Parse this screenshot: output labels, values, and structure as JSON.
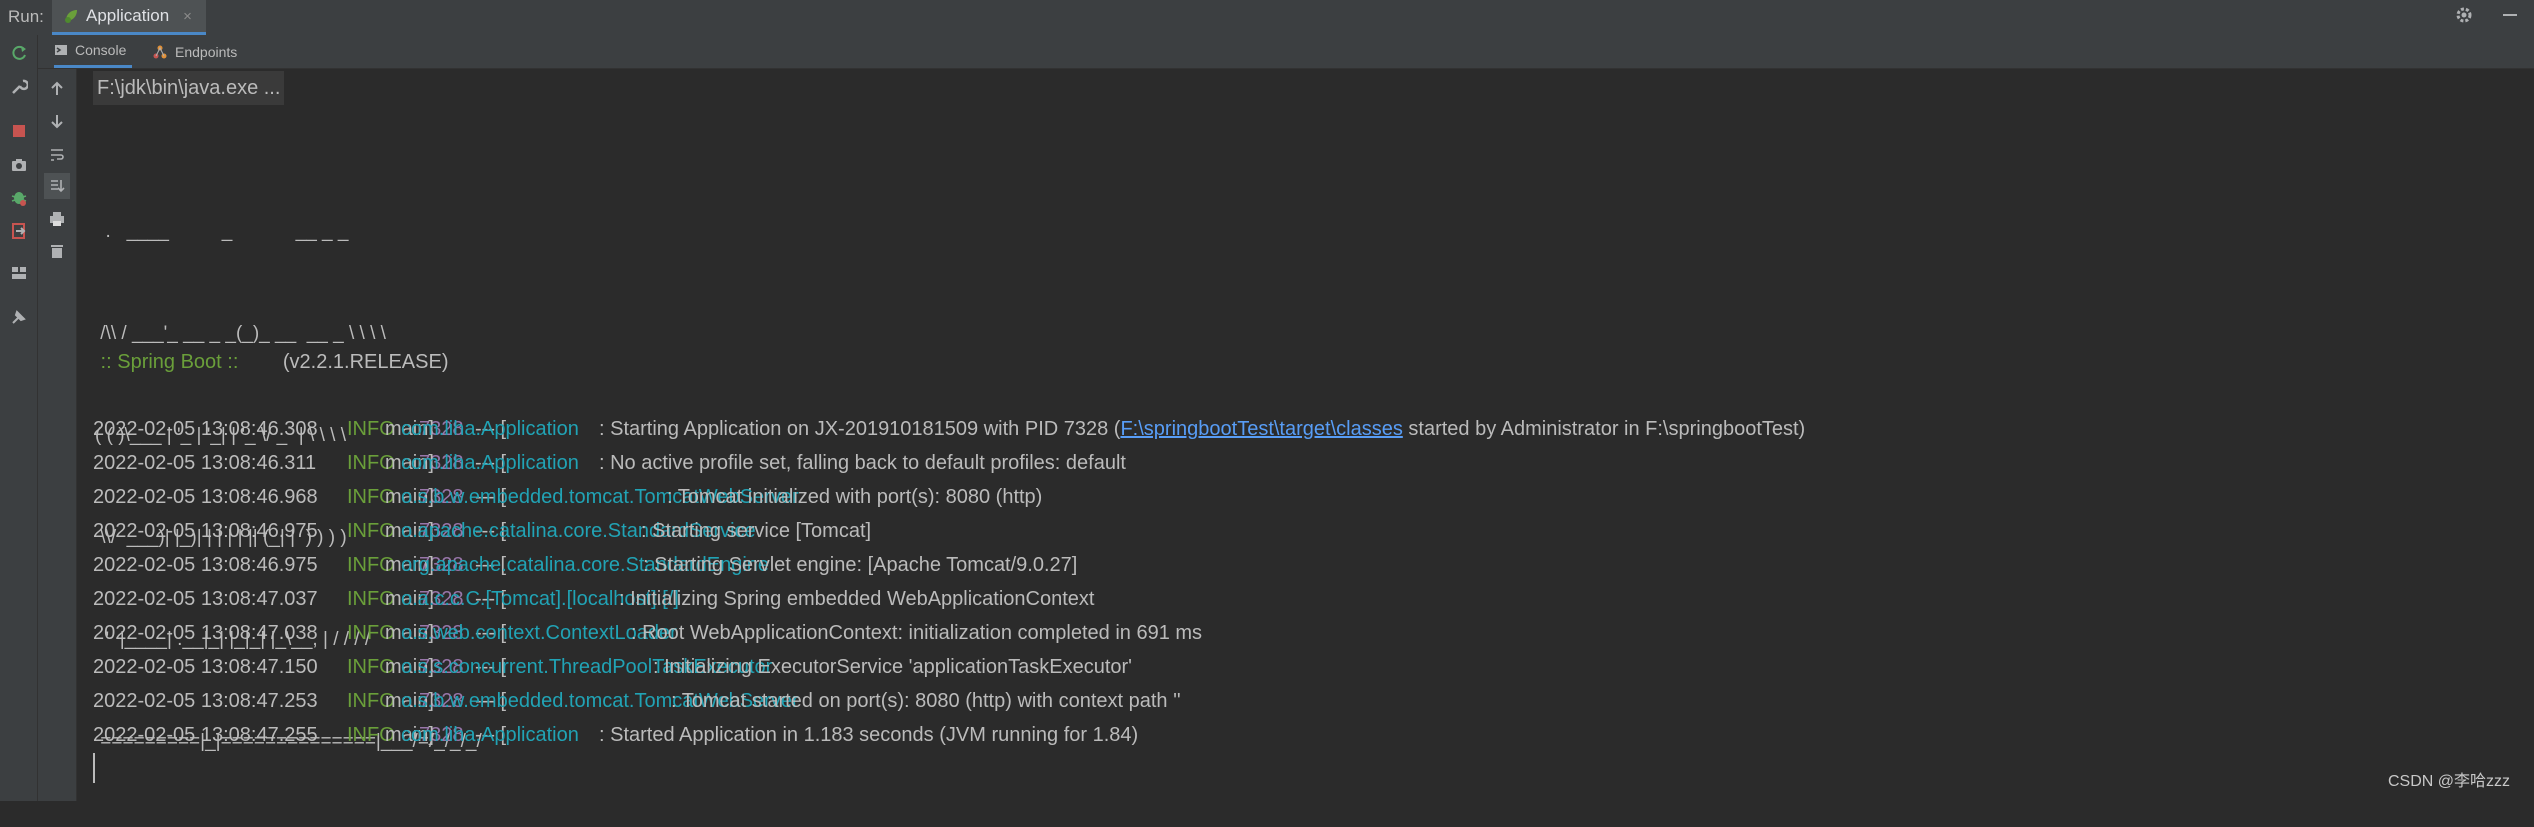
{
  "topbar": {
    "run_label": "Run:",
    "tab_title": "Application",
    "tab_close": "×"
  },
  "subtabs": [
    {
      "label": "Console"
    },
    {
      "label": "Endpoints"
    }
  ],
  "console": {
    "command": "F:\\jdk\\bin\\java.exe ...",
    "banner": [
      "  .   ____          _            __ _ _",
      " /\\\\ / ___'_ __ _ _(_)_ __  __ _ \\ \\ \\ \\",
      "( ( )\\___ | '_ | '_| | '_ \\/ _` | \\ \\ \\ \\",
      " \\\\/  ___)| |_)| | | | | || (_| |  ) ) ) )",
      "  '  |____| .__|_| |_|_| |_\\__, | / / / /",
      " =========|_|==============|___/=/_/_/_/"
    ],
    "boot_label": " :: Spring Boot :: ",
    "boot_version": "       (v2.2.1.RELEASE)",
    "logs": [
      {
        "ts": "2022-02-05 13:08:46.308",
        "level": "INFO",
        "pid": "7328",
        "sep": "--- [",
        "thread": "main]",
        "logger": "com.liha.Application",
        "msg": ": Starting Application on JX-201910181509 with PID 7328 (",
        "link": "F:\\springbootTest\\target\\classes",
        "msg2": " started by Administrator in F:\\springbootTest)"
      },
      {
        "ts": "2022-02-05 13:08:46.311",
        "level": "INFO",
        "pid": "7328",
        "sep": "--- [",
        "thread": "main]",
        "logger": "com.liha.Application",
        "msg": ": No active profile set, falling back to default profiles: default"
      },
      {
        "ts": "2022-02-05 13:08:46.968",
        "level": "INFO",
        "pid": "7328",
        "sep": "--- [",
        "thread": "main]",
        "logger": "o.s.b.w.embedded.tomcat.TomcatWebServer",
        "msg": ": Tomcat initialized with port(s): 8080 (http)"
      },
      {
        "ts": "2022-02-05 13:08:46.975",
        "level": "INFO",
        "pid": "7328",
        "sep": "--- [",
        "thread": "main]",
        "logger": "o.apache.catalina.core.StandardService",
        "msg": ": Starting service [Tomcat]"
      },
      {
        "ts": "2022-02-05 13:08:46.975",
        "level": "INFO",
        "pid": "7328",
        "sep": "--- [",
        "thread": "main]",
        "logger": "org.apache.catalina.core.StandardEngine",
        "msg": ": Starting Servlet engine: [Apache Tomcat/9.0.27]"
      },
      {
        "ts": "2022-02-05 13:08:47.037",
        "level": "INFO",
        "pid": "7328",
        "sep": "--- [",
        "thread": "main]",
        "logger": "o.a.c.c.C.[Tomcat].[localhost].[/]",
        "msg": ": Initializing Spring embedded WebApplicationContext"
      },
      {
        "ts": "2022-02-05 13:08:47.038",
        "level": "INFO",
        "pid": "7328",
        "sep": "--- [",
        "thread": "main]",
        "logger": "o.s.web.context.ContextLoader",
        "msg": ": Root WebApplicationContext: initialization completed in 691 ms"
      },
      {
        "ts": "2022-02-05 13:08:47.150",
        "level": "INFO",
        "pid": "7328",
        "sep": "--- [",
        "thread": "main]",
        "logger": "o.s.s.concurrent.ThreadPoolTaskExecutor",
        "msg": ": Initializing ExecutorService 'applicationTaskExecutor'"
      },
      {
        "ts": "2022-02-05 13:08:47.253",
        "level": "INFO",
        "pid": "7328",
        "sep": "--- [",
        "thread": "main]",
        "logger": "o.s.b.w.embedded.tomcat.TomcatWebServer",
        "msg": ": Tomcat started on port(s): 8080 (http) with context path ''"
      },
      {
        "ts": "2022-02-05 13:08:47.255",
        "level": "INFO",
        "pid": "7328",
        "sep": "--- [",
        "thread": "main]",
        "logger": "com.liha.Application",
        "msg": ": Started Application in 1.183 seconds (JVM running for 1.84)"
      }
    ]
  },
  "watermark": "CSDN @李哈zzz",
  "colors": {
    "background": "#2b2b2b",
    "info": "#6a9f3a",
    "pid": "#9876aa",
    "logger": "#21a3b5",
    "link": "#589df6"
  }
}
